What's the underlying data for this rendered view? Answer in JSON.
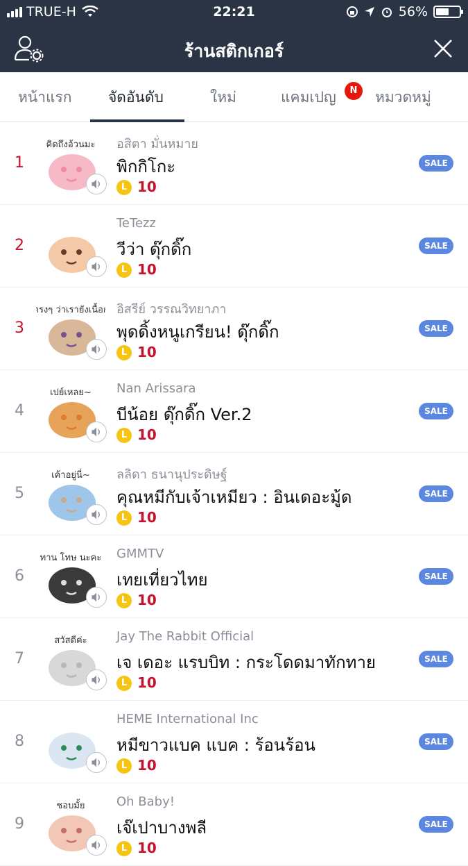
{
  "status_bar": {
    "carrier": "TRUE-H",
    "time": "22:21",
    "battery": "56%",
    "battery_level": 0.56
  },
  "header": {
    "title": "ร้านสติกเกอร์"
  },
  "tabs": [
    {
      "label": "หน้าแรก"
    },
    {
      "label": "จัดอันดับ"
    },
    {
      "label": "ใหม่"
    },
    {
      "label": "แคมเปญ",
      "badge": "N"
    },
    {
      "label": "หมวดหมู่"
    }
  ],
  "colors": {
    "nav_bg": "#2b3445",
    "rank_top": "#c8112d",
    "sale_badge": "#5b87e0",
    "coin": "#f6c511"
  },
  "items": [
    {
      "rank": "1",
      "author": "อสิตา มั่นหมาย",
      "name": "พิกกิโกะ",
      "price": "10",
      "badge": "SALE",
      "sticker_text": "คิดถึงอ้วนมะ"
    },
    {
      "rank": "2",
      "author": "TeTezz",
      "name": "วีว่า ดุ๊กดิ๊ก",
      "price": "10",
      "badge": "SALE",
      "sticker_text": ""
    },
    {
      "rank": "3",
      "author": "อิสรีย์ วรรณวิทยาภา",
      "name": "พุดดิ้งหนูเกรียน! ดุ๊กดิ๊ก",
      "price": "10",
      "badge": "SALE",
      "sticker_text": "บอกตรงๆ ว่าเรายังเนื้อกมาก"
    },
    {
      "rank": "4",
      "author": "Nan Arissara",
      "name": "บีน้อย ดุ๊กดิ๊ก Ver.2",
      "price": "10",
      "badge": "SALE",
      "sticker_text": "เปย์เหลย~"
    },
    {
      "rank": "5",
      "author": "ลลิดา ธนานุประดิษฐ์",
      "name": "คุณหมีกับเจ้าเหมียว : อินเดอะมู้ด",
      "price": "10",
      "badge": "SALE",
      "sticker_text": "เค้าอยู่นี่~"
    },
    {
      "rank": "6",
      "author": "GMMTV",
      "name": "เทยเที่ยวไทย",
      "price": "10",
      "badge": "SALE",
      "sticker_text": "ทาน โทษ นะคะ"
    },
    {
      "rank": "7",
      "author": "Jay The Rabbit Official",
      "name": "เจ เดอะ แรบบิท : กระโดดมาทักทาย",
      "price": "10",
      "badge": "SALE",
      "sticker_text": "สวัสดีค่ะ"
    },
    {
      "rank": "8",
      "author": "HEME International Inc",
      "name": "หมีขาวแบค แบค : ร้อนร้อน",
      "price": "10",
      "badge": "SALE",
      "sticker_text": ""
    },
    {
      "rank": "9",
      "author": "Oh Baby!",
      "name": "เจ๊เปาบางพลี",
      "price": "10",
      "badge": "SALE",
      "sticker_text": "ชอบมั้ย"
    }
  ]
}
